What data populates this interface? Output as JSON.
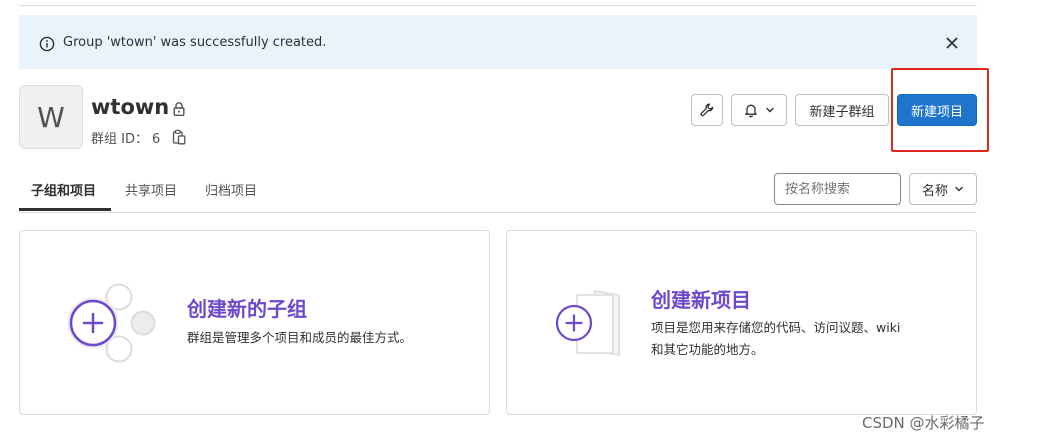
{
  "flash": {
    "message": "Group 'wtown' was successfully created.",
    "info_icon": "info-circle-icon",
    "close_icon": "close-icon"
  },
  "group": {
    "avatar_letter": "W",
    "name": "wtown",
    "visibility_icon": "lock-icon",
    "id_label": "群组 ID：",
    "id_value": "6",
    "copy_icon": "copy-to-clipboard-icon"
  },
  "actions": {
    "settings_icon": "wrench-icon",
    "notifications_icon": "bell-icon",
    "new_subgroup": "新建子群组",
    "new_project": "新建项目"
  },
  "tabs": [
    {
      "label": "子组和项目",
      "active": true
    },
    {
      "label": "共享项目",
      "active": false
    },
    {
      "label": "归档项目",
      "active": false
    }
  ],
  "filter": {
    "search_placeholder": "按名称搜索",
    "sort_label": "名称"
  },
  "cards": {
    "subgroup": {
      "title": "创建新的子组",
      "description": "群组是管理多个项目和成员的最佳方式。"
    },
    "project": {
      "title": "创建新项目",
      "description_line1": "项目是您用来存储您的代码、访问议题、wiki",
      "description_line2": "和其它功能的地方。"
    }
  },
  "watermark": "CSDN @水彩橘子",
  "colors": {
    "flash_bg": "#e9f3fc",
    "primary_button": "#1f75cb",
    "card_title": "#6e49cb",
    "highlight_box": "#e0281f"
  }
}
